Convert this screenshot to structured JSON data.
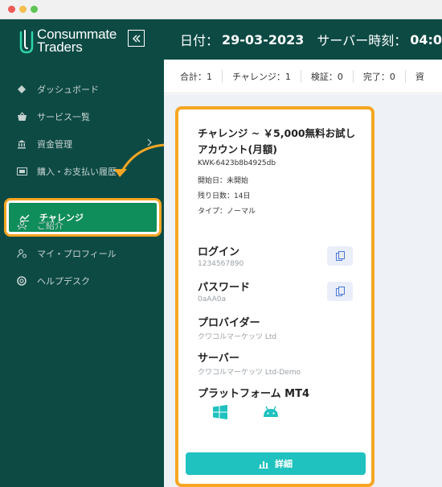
{
  "brand": {
    "line1": "Consummate",
    "line2": "Traders"
  },
  "header": {
    "date_label": "日付：",
    "date_value": "29-03-2023",
    "server_time_label": "サーバー時刻：",
    "server_time_value": "04:0"
  },
  "sidebar": {
    "items": [
      {
        "label": "ダッシュボード",
        "icon": "dashboard-icon"
      },
      {
        "label": "サービス一覧",
        "icon": "basket-icon"
      },
      {
        "label": "資金管理",
        "icon": "bank-icon"
      },
      {
        "label": "購入・お支払い履歴",
        "icon": "ticket-icon"
      },
      {
        "label": "チャレンジ",
        "icon": "chart-line-icon"
      },
      {
        "label": "ご紹介",
        "icon": "users-icon"
      },
      {
        "label": "マイ・プロフィール",
        "icon": "user-settings-icon"
      },
      {
        "label": "ヘルプデスク",
        "icon": "lifebuoy-icon"
      }
    ]
  },
  "stats": [
    "合計：1",
    "チャレンジ：1",
    "検証：0",
    "完了：0",
    "資"
  ],
  "card": {
    "title": "チャレンジ ~ ￥5,000無料お試しアカウント(月額)",
    "account_id": "KWK-6423b8b4925db",
    "start_date": "開始日：未開始",
    "days_remaining": "残り日数：14日",
    "type": "タイプ：ノーマル",
    "login_label": "ログイン",
    "login_value": "1234567890",
    "password_label": "パスワード",
    "password_value": "0aAA0a",
    "provider_label": "プロバイダー",
    "provider_value": "クワコルマーケッツ Ltd",
    "server_label": "サーバー",
    "server_value": "クワコルマーケッツ Ltd-Demo",
    "platform_label": "プラットフォーム MT4",
    "detail_button": "詳細"
  },
  "colors": {
    "sidebar_bg": "#0d4a44",
    "active_bg": "#0f8d5a",
    "highlight": "#f5a623",
    "accent": "#1fc2be"
  }
}
